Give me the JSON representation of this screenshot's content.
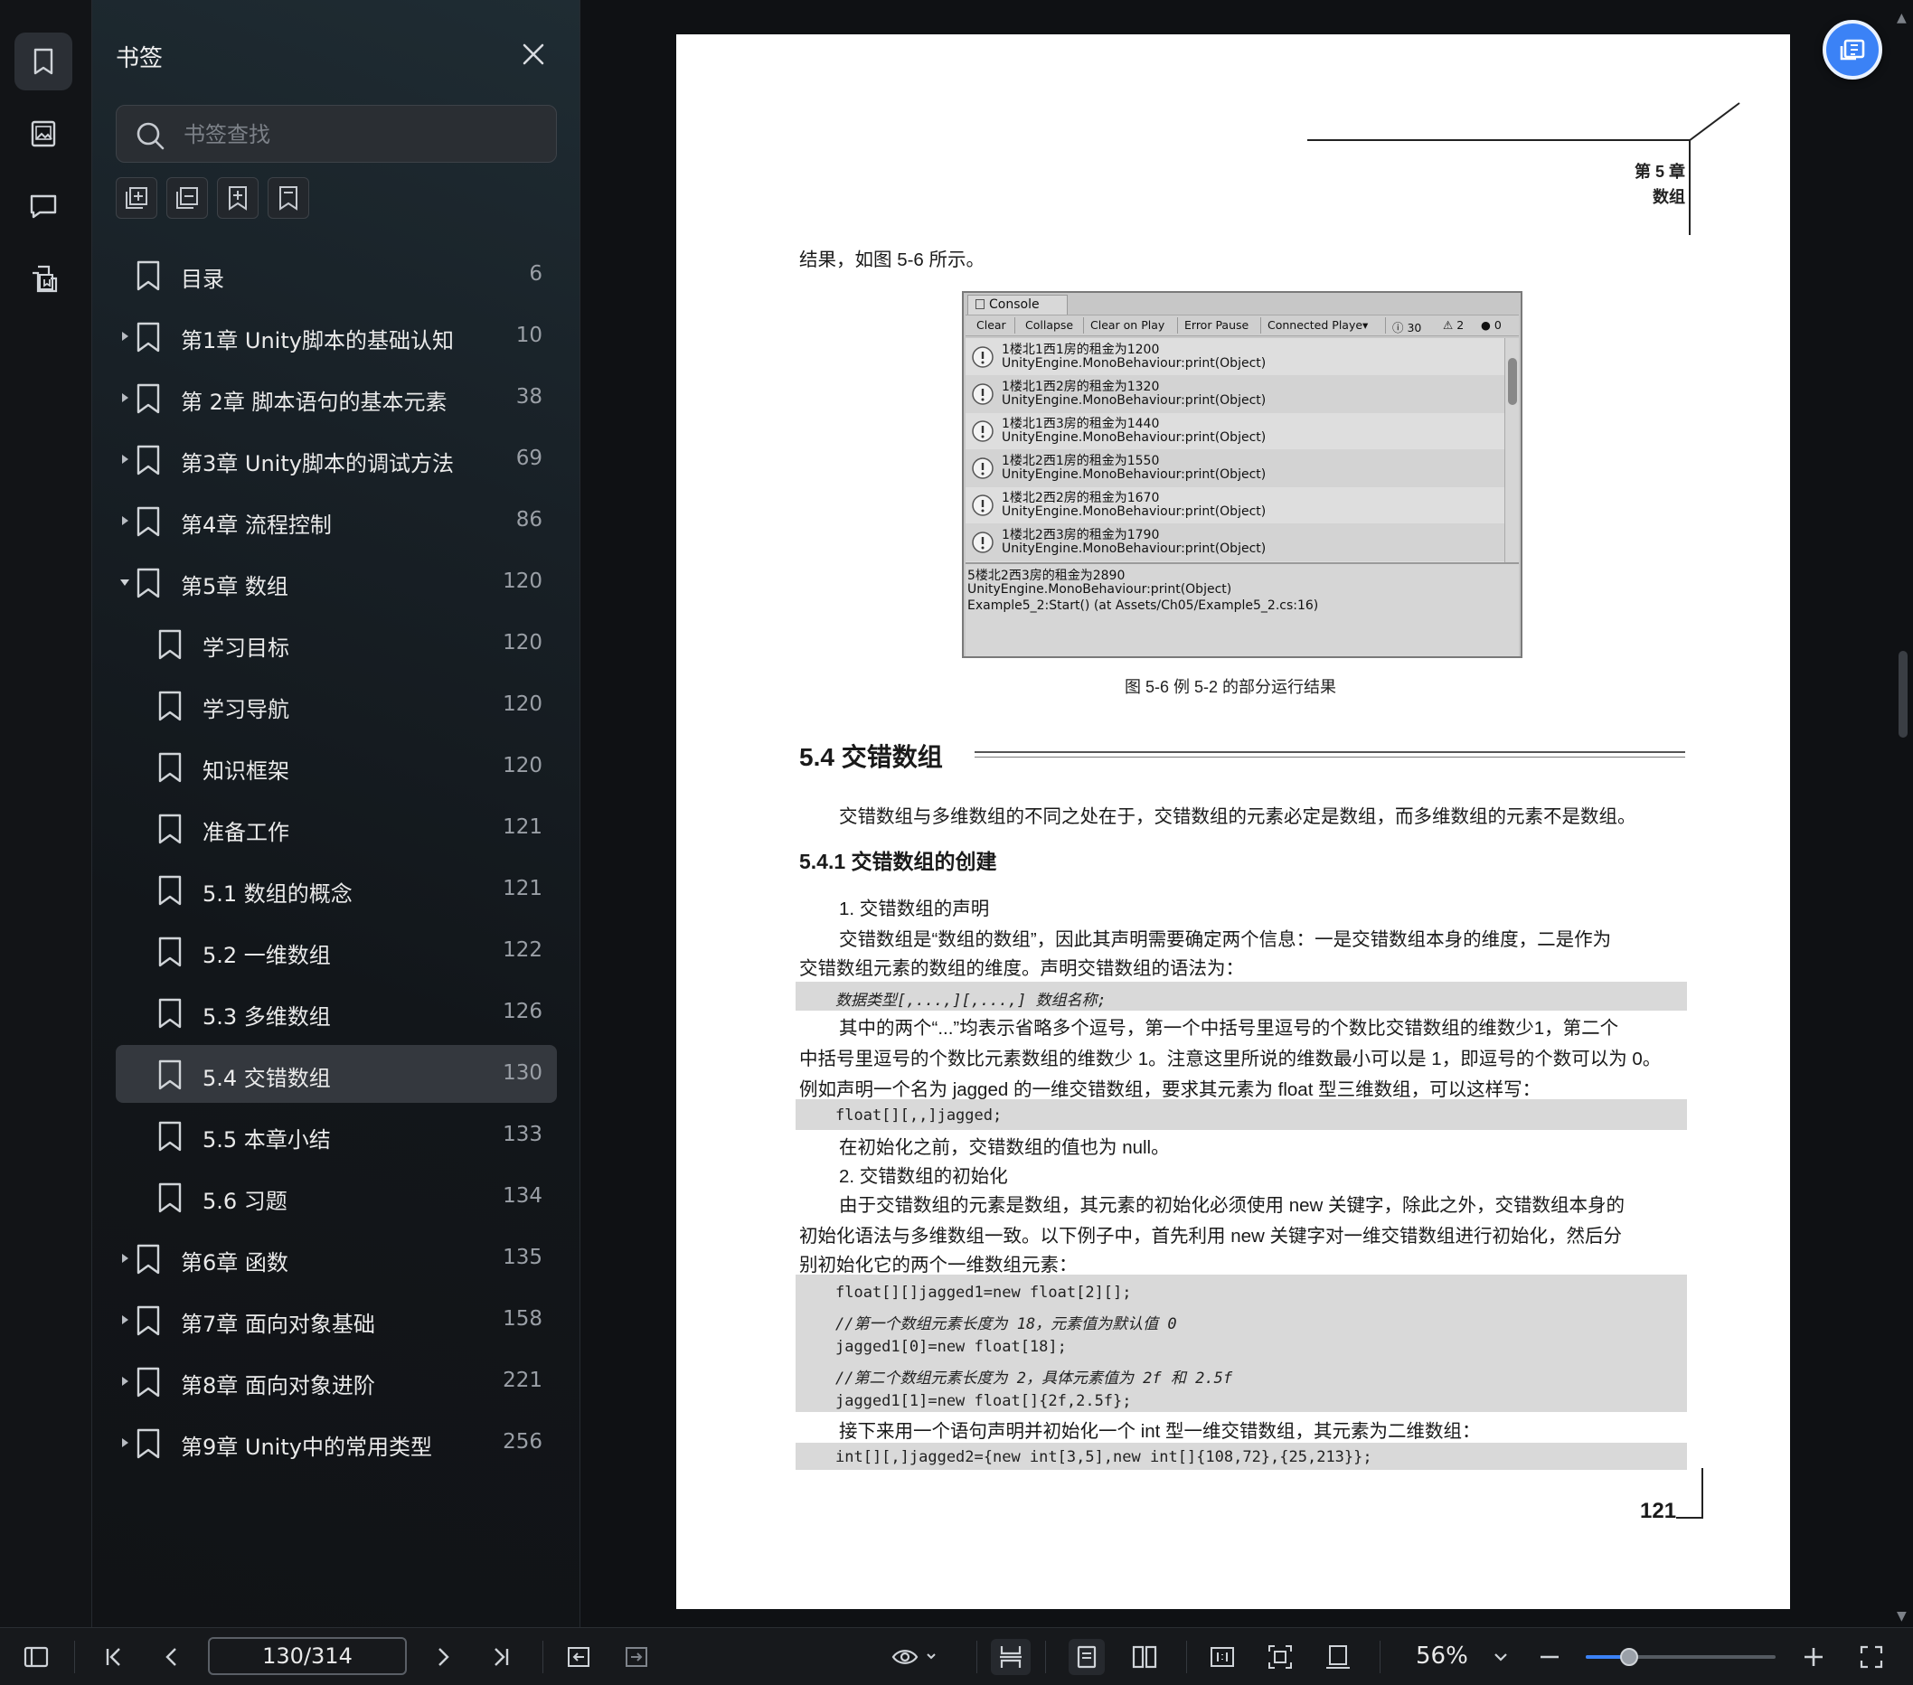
{
  "rail": {
    "items": [
      {
        "name": "bookmark",
        "active": true
      },
      {
        "name": "thumbnail",
        "active": false
      },
      {
        "name": "comment",
        "active": false
      },
      {
        "name": "extract",
        "active": false
      }
    ]
  },
  "panel": {
    "title": "书签",
    "search_placeholder": "书签查找",
    "tools": [
      "expand-all",
      "collapse-all",
      "add-bookmark",
      "bookmark"
    ],
    "bookmarks": [
      {
        "label": "目录",
        "page": "6",
        "level": 0,
        "arrow": "none"
      },
      {
        "label": "第1章 Unity脚本的基础认知",
        "page": "10",
        "level": 0,
        "arrow": "right"
      },
      {
        "label": "第 2章 脚本语句的基本元素",
        "page": "38",
        "level": 0,
        "arrow": "right"
      },
      {
        "label": "第3章 Unity脚本的调试方法",
        "page": "69",
        "level": 0,
        "arrow": "right"
      },
      {
        "label": "第4章 流程控制",
        "page": "86",
        "level": 0,
        "arrow": "right"
      },
      {
        "label": "第5章 数组",
        "page": "120",
        "level": 0,
        "arrow": "down"
      },
      {
        "label": "学习目标",
        "page": "120",
        "level": 1,
        "arrow": "none"
      },
      {
        "label": "学习导航",
        "page": "120",
        "level": 1,
        "arrow": "none"
      },
      {
        "label": "知识框架",
        "page": "120",
        "level": 1,
        "arrow": "none"
      },
      {
        "label": "准备工作",
        "page": "121",
        "level": 1,
        "arrow": "none"
      },
      {
        "label": "5.1 数组的概念",
        "page": "121",
        "level": 1,
        "arrow": "none"
      },
      {
        "label": "5.2 一维数组",
        "page": "122",
        "level": 1,
        "arrow": "none"
      },
      {
        "label": "5.3 多维数组",
        "page": "126",
        "level": 1,
        "arrow": "none"
      },
      {
        "label": "5.4 交错数组",
        "page": "130",
        "level": 1,
        "arrow": "none",
        "selected": true
      },
      {
        "label": "5.5 本章小结",
        "page": "133",
        "level": 1,
        "arrow": "none"
      },
      {
        "label": "5.6 习题",
        "page": "134",
        "level": 1,
        "arrow": "none"
      },
      {
        "label": "第6章 函数",
        "page": "135",
        "level": 0,
        "arrow": "right"
      },
      {
        "label": "第7章 面向对象基础",
        "page": "158",
        "level": 0,
        "arrow": "right"
      },
      {
        "label": "第8章 面向对象进阶",
        "page": "221",
        "level": 0,
        "arrow": "right"
      },
      {
        "label": "第9章 Unity中的常用类型",
        "page": "256",
        "level": 0,
        "arrow": "right"
      }
    ]
  },
  "page": {
    "header_chapter": "第 5 章",
    "header_title": "数组",
    "intro": "结果，如图 5-6 所示。",
    "console": {
      "tab": "Console",
      "buttons": [
        "Clear",
        "Collapse",
        "Clear on Play",
        "Error Pause",
        "Connected Playe▾"
      ],
      "counts": [
        "30",
        "2",
        "0"
      ],
      "rows": [
        {
          "line1": "1楼北1西1房的租金为1200",
          "line2": "UnityEngine.MonoBehaviour:print(Object)"
        },
        {
          "line1": "1楼北1西2房的租金为1320",
          "line2": "UnityEngine.MonoBehaviour:print(Object)"
        },
        {
          "line1": "1楼北1西3房的租金为1440",
          "line2": "UnityEngine.MonoBehaviour:print(Object)"
        },
        {
          "line1": "1楼北2西1房的租金为1550",
          "line2": "UnityEngine.MonoBehaviour:print(Object)"
        },
        {
          "line1": "1楼北2西2房的租金为1670",
          "line2": "UnityEngine.MonoBehaviour:print(Object)"
        },
        {
          "line1": "1楼北2西3房的租金为1790",
          "line2": "UnityEngine.MonoBehaviour:print(Object)"
        }
      ],
      "detail": [
        "5楼北2西3房的租金为2890",
        "UnityEngine.MonoBehaviour:print(Object)",
        "Example5_2:Start() (at Assets/Ch05/Example5_2.cs:16)"
      ]
    },
    "figure_caption": "图 5-6   例 5-2 的部分运行结果",
    "section_title": "5.4    交错数组",
    "section_intro": "交错数组与多维数组的不同之处在于，交错数组的元素必定是数组，而多维数组的元素不是数组。",
    "subsection_title": "5.4.1    交错数组的创建",
    "p1_heading": "1. 交错数组的声明",
    "p1_line1": "交错数组是“数组的数组”，因此其声明需要确定两个信息：一是交错数组本身的维度，二是作为",
    "p1_line2": "交错数组元素的数组的维度。声明交错数组的语法为：",
    "code1": "数据类型[,...,][,...,] 数组名称;",
    "p2_line1": "其中的两个“...”均表示省略多个逗号，第一个中括号里逗号的个数比交错数组的维数少1，第二个",
    "p2_line2": "中括号里逗号的个数比元素数组的维数少 1。注意这里所说的维数最小可以是 1，即逗号的个数可以为 0。",
    "p2_line3": "例如声明一个名为 jagged 的一维交错数组，要求其元素为 float 型三维数组，可以这样写：",
    "code2": "float[][,,]jagged;",
    "p3": "在初始化之前，交错数组的值也为 null。",
    "p4_heading": "2. 交错数组的初始化",
    "p4_line1": "由于交错数组的元素是数组，其元素的初始化必须使用  new  关键字，除此之外，交错数组本身的",
    "p4_line2": "初始化语法与多维数组一致。以下例子中，首先利用  new  关键字对一维交错数组进行初始化，然后分",
    "p4_line3": "别初始化它的两个一维数组元素：",
    "code3": [
      "float[][]jagged1=new float[2][];",
      "//第一个数组元素长度为 18，元素值为默认值 0",
      "jagged1[0]=new float[18];",
      "//第二个数组元素长度为 2，具体元素值为 2f 和 2.5f",
      "jagged1[1]=new float[]{2f,2.5f};"
    ],
    "p5": "接下来用一个语句声明并初始化一个 int 型一维交错数组，其元素为二维数组：",
    "code4": "int[][,]jagged2={new int[3,5],new int[]{108,72},{25,213}};",
    "page_number": "121"
  },
  "toolbar": {
    "page_value": "130/314",
    "zoom_value": "56%",
    "zoom_fraction": 0.23
  },
  "colors": {
    "accent": "#3b82f6",
    "panel_bg": "#1a1f24",
    "selected_bg": "#34383e"
  }
}
